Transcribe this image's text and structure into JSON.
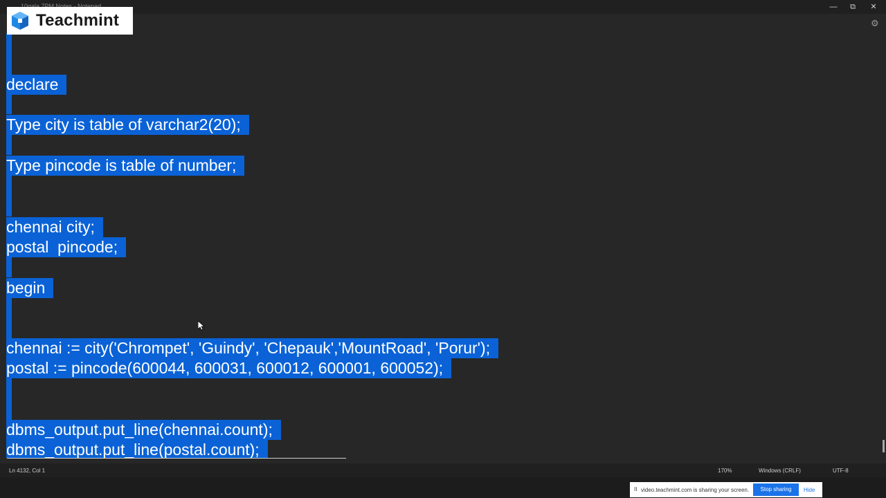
{
  "window": {
    "title": "10gala 7PM Notes - Notepad",
    "controls": {
      "minimize": "—",
      "maximize": "⧉",
      "close": "✕"
    }
  },
  "logo": {
    "text": "Teachmint",
    "icon": "teachmint-cube-icon",
    "accent": "#1e88e5"
  },
  "editor": {
    "selection_color": "#0a62d6",
    "background": "#272727",
    "lines": [
      "declare",
      "Type city is table of varchar2(20);",
      "Type pincode is table of number;",
      "chennai city;",
      "postal  pincode;",
      "begin",
      "chennai := city('Chrompet', 'Guindy', 'Chepauk','MountRoad', 'Porur');",
      "postal := pincode(600044, 600031, 600012, 600001, 600052);",
      "dbms_output.put_line(chennai.count);",
      "dbms_output.put_line(postal.count);"
    ]
  },
  "statusbar": {
    "position": "Ln 4132, Col 1",
    "zoom": "170%",
    "line_ending": "Windows (CRLF)",
    "encoding": "UTF-8"
  },
  "share_bar": {
    "pause": "II",
    "message": "video.teachmint.com is sharing your screen.",
    "stop_label": "Stop sharing",
    "hide_label": "Hide"
  }
}
